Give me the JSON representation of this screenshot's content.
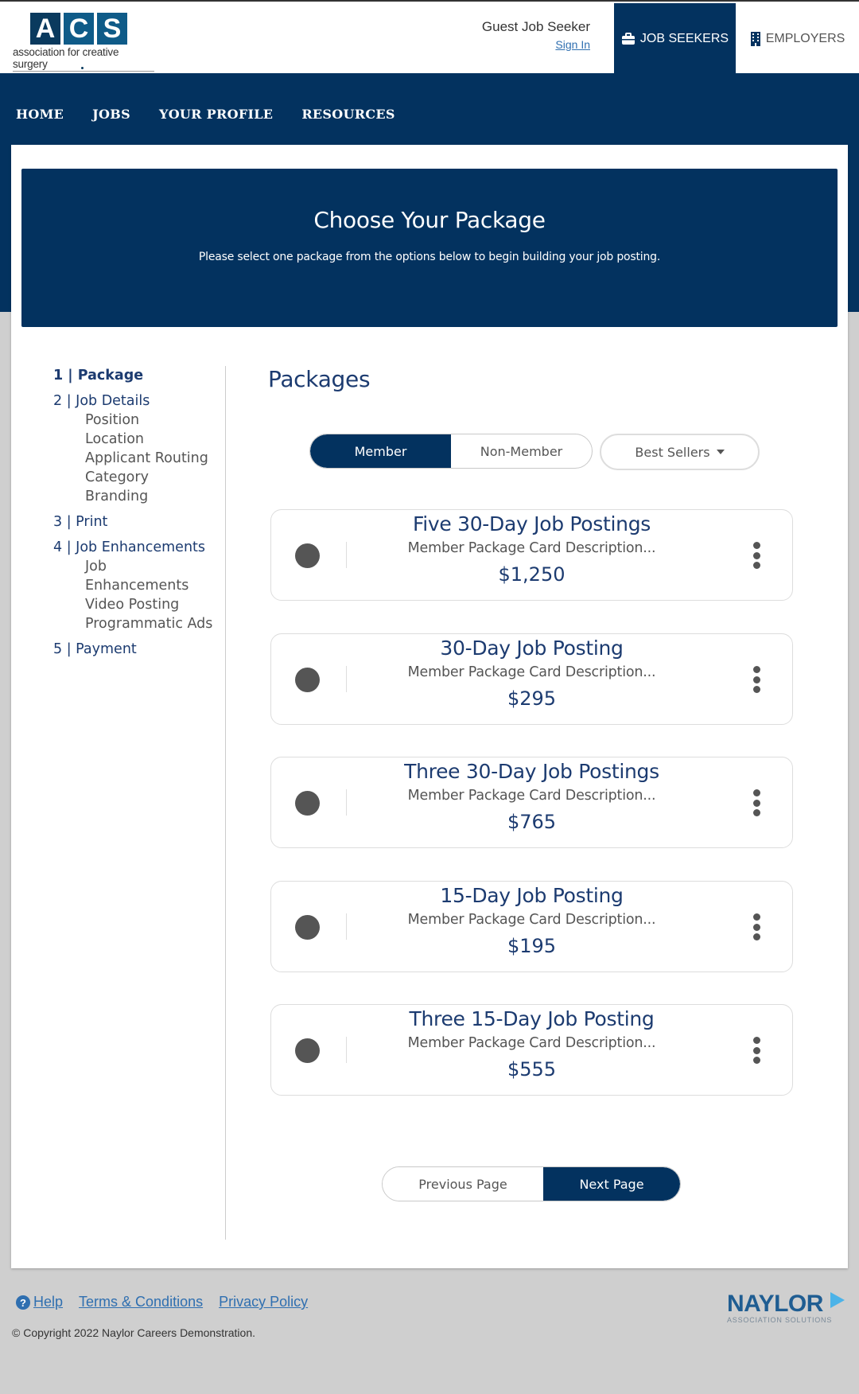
{
  "header": {
    "logo": {
      "letters": [
        "A",
        "C",
        "S"
      ],
      "tagline": "association for creative surgery"
    },
    "guest_name": "Guest Job Seeker",
    "sign_in": "Sign In",
    "tabs": [
      {
        "label": "JOB SEEKERS",
        "icon": "briefcase-icon",
        "active": true
      },
      {
        "label": "EMPLOYERS",
        "icon": "building-icon",
        "active": false
      }
    ]
  },
  "nav": {
    "items": [
      "HOME",
      "JOBS",
      "YOUR PROFILE",
      "RESOURCES"
    ]
  },
  "banner": {
    "title": "Choose Your Package",
    "subtitle": "Please select one package from the options below to begin building your job posting."
  },
  "steps": [
    {
      "label": "1 | Package",
      "active": true,
      "sub": []
    },
    {
      "label": "2 | Job Details",
      "active": false,
      "sub": [
        "Position",
        "Location",
        "Applicant Routing",
        "Category",
        "Branding"
      ]
    },
    {
      "label": "3 | Print",
      "active": false,
      "sub": []
    },
    {
      "label": "4 | Job Enhancements",
      "active": false,
      "sub": [
        "Job",
        "Enhancements",
        "Video Posting",
        "Programmatic Ads"
      ]
    },
    {
      "label": "5 | Payment",
      "active": false,
      "sub": []
    }
  ],
  "packages_title": "Packages",
  "toggle": {
    "options": [
      "Member",
      "Non-Member"
    ],
    "selected": "Member"
  },
  "dropdown": {
    "label": "Best Sellers"
  },
  "packages": [
    {
      "name": "Five 30-Day Job Postings",
      "description": "Member Package Card Description...",
      "price": "$1,250"
    },
    {
      "name": "30-Day Job Posting",
      "description": "Member Package Card Description...",
      "price": "$295"
    },
    {
      "name": "Three 30-Day Job Postings",
      "description": "Member Package Card Description...",
      "price": "$765"
    },
    {
      "name": "15-Day Job Posting",
      "description": "Member Package Card Description...",
      "price": "$195"
    },
    {
      "name": "Three 15-Day Job Posting",
      "description": "Member Package Card Description...",
      "price": "$555"
    }
  ],
  "pager": {
    "previous": "Previous Page",
    "next": "Next Page"
  },
  "footer": {
    "links": [
      "Help",
      "Terms & Conditions",
      "Privacy Policy"
    ],
    "copyright": "© Copyright 2022 Naylor Careers Demonstration.",
    "brand": {
      "name": "NAYLOR",
      "sub": "ASSOCIATION SOLUTIONS"
    }
  },
  "colors": {
    "primary": "#03325f",
    "link": "#2f6fb0",
    "background": "#cfcfcf"
  }
}
